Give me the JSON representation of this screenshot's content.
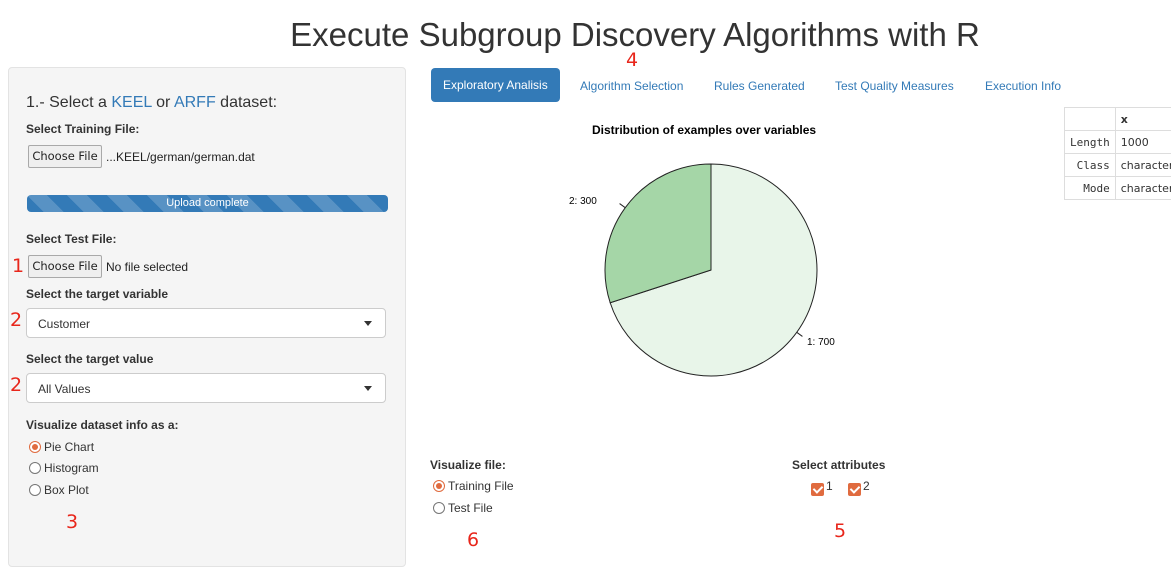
{
  "page": {
    "title": "Execute Subgroup Discovery Algorithms with R"
  },
  "sidebar": {
    "heading_prefix": "1.- Select a ",
    "keel_link": "KEEL",
    "heading_mid": " or ",
    "arff_link": "ARFF",
    "heading_suffix": " dataset:",
    "training_label": "Select Training File:",
    "training_button": "Choose File",
    "training_file": "...KEEL/german/german.dat",
    "upload_status": "Upload complete",
    "upload_progress_percent": 100,
    "test_label": "Select Test File:",
    "test_button": "Choose File",
    "test_file": "No file selected",
    "target_variable_label": "Select the target variable",
    "target_variable_value": "Customer",
    "target_value_label": "Select the target value",
    "target_value_value": "All Values",
    "visualize_label": "Visualize dataset info as a:",
    "visualize_options": [
      {
        "label": "Pie Chart",
        "selected": true
      },
      {
        "label": "Histogram",
        "selected": false
      },
      {
        "label": "Box Plot",
        "selected": false
      }
    ]
  },
  "tabs": [
    {
      "label": "Exploratory Analisis",
      "active": true
    },
    {
      "label": "Algorithm Selection",
      "active": false
    },
    {
      "label": "Rules Generated",
      "active": false
    },
    {
      "label": "Test Quality Measures",
      "active": false
    },
    {
      "label": "Execution Info",
      "active": false
    }
  ],
  "chart_data": {
    "type": "pie",
    "title": "Distribution of examples over variables",
    "slices": [
      {
        "label": "1: 700",
        "value": 700,
        "color": "#e8f5e9"
      },
      {
        "label": "2: 300",
        "value": 300,
        "color": "#a5d6a7"
      }
    ]
  },
  "summary_table": {
    "header": [
      "",
      "x"
    ],
    "rows": [
      {
        "key": "Length",
        "value": "1000"
      },
      {
        "key": "Class",
        "value": "character"
      },
      {
        "key": "Mode",
        "value": "character"
      }
    ]
  },
  "visualize_file": {
    "label": "Visualize file:",
    "options": [
      {
        "label": "Training File",
        "selected": true
      },
      {
        "label": "Test File",
        "selected": false
      }
    ]
  },
  "attributes": {
    "label": "Select attributes",
    "options": [
      {
        "label": "1",
        "checked": true
      },
      {
        "label": "2",
        "checked": true
      }
    ]
  },
  "annotations": {
    "a1": "1",
    "a2a": "2",
    "a2b": "2",
    "a3": "3",
    "a4": "4",
    "a5": "5",
    "a6": "6"
  },
  "colors": {
    "accent": "#337ab7",
    "radio": "#e06b3f",
    "annotation": "#e8261b"
  }
}
